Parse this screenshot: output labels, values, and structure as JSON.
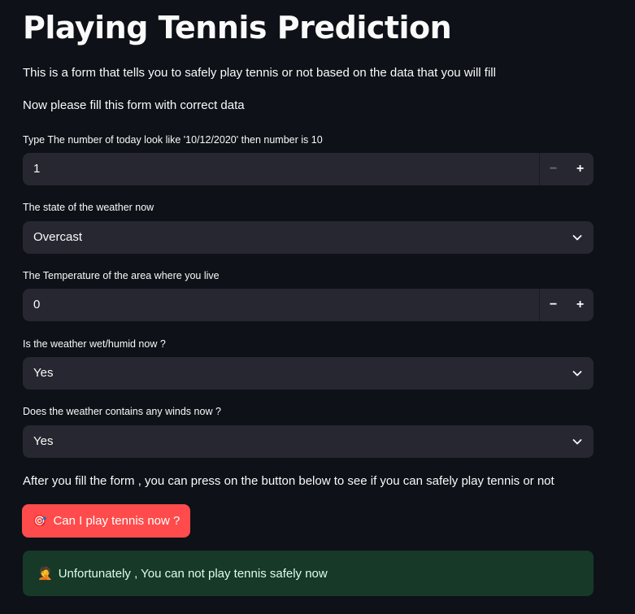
{
  "page": {
    "title": "Playing Tennis Prediction",
    "intro": "This is a form that tells you to safely play tennis or not based on the data that you will fill",
    "instruction": "Now please fill this form with correct data",
    "after_form_text": "After you fill the form , you can press on the button below to see if you can safely play tennis or not"
  },
  "form": {
    "day": {
      "label": "Type The number of today look like '10/12/2020' then number is 10",
      "value": "1",
      "minus": "−",
      "plus": "+"
    },
    "weather": {
      "label": "The state of the weather now",
      "selected": "Overcast"
    },
    "temperature": {
      "label": "The Temperature of the area where you live",
      "value": "0",
      "minus": "−",
      "plus": "+"
    },
    "humid": {
      "label": "Is the weather wet/humid now ?",
      "selected": "Yes"
    },
    "windy": {
      "label": "Does the weather contains any winds now ?",
      "selected": "Yes"
    }
  },
  "predict_button": {
    "icon": "🎯",
    "label": "Can I play tennis now ?"
  },
  "result": {
    "icon": "🤦",
    "text": "Unfortunately , You can not play tennis safely now"
  },
  "colors": {
    "background": "#0e1117",
    "input_bg": "#262730",
    "primary": "#ff4b4b",
    "success_bg": "#173928"
  }
}
